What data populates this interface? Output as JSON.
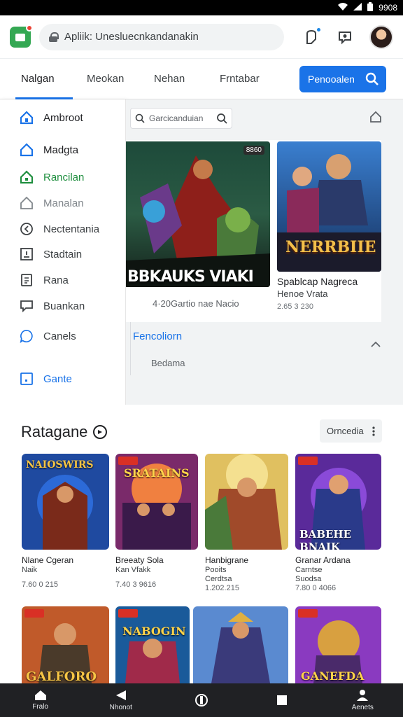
{
  "status_bar": {
    "time": "9908"
  },
  "browser": {
    "url": "Apliik: Unesluecnkandanakin"
  },
  "tabs": [
    {
      "label": "Nalgan"
    },
    {
      "label": "Meokan"
    },
    {
      "label": "Nehan"
    },
    {
      "label": "Frntabar"
    }
  ],
  "cta": {
    "label": "Penooalen"
  },
  "sidebar": {
    "items": [
      {
        "label": "Ambroot",
        "icon": "home-icon"
      },
      {
        "label": "Madgta",
        "icon": "home-icon"
      },
      {
        "label": "Rancilan",
        "icon": "home-icon"
      },
      {
        "label": "Manalan",
        "icon": "home-icon"
      },
      {
        "label": "Nectentania",
        "icon": "compass-icon"
      },
      {
        "label": "Stadtain",
        "icon": "file-icon"
      },
      {
        "label": "Rana",
        "icon": "list-icon"
      },
      {
        "label": "Buankan",
        "icon": "chat-icon"
      },
      {
        "label": "Canels",
        "icon": "bubble-icon"
      },
      {
        "label": "Gante",
        "icon": "square-icon"
      }
    ]
  },
  "main": {
    "search_placeholder": "Garcicanduian",
    "featured": {
      "title": "BBKAUKS VIAKI",
      "badge": "8860",
      "caption": "4·20Gartio nae Nacio"
    },
    "side_featured": {
      "logo": "NERRBIIE",
      "title": "Spablcap Nagreca",
      "sub": "Henoe Vrata",
      "meta": "2.65 3 230"
    },
    "section_link": "Fencoliorn",
    "section_sub": "Bedama"
  },
  "section2": {
    "title": "Ratagane",
    "sort_label": "Orncedia",
    "cards": [
      {
        "title": "Nlane Cgeran",
        "sub": "Naik",
        "meta": "7.60 0 215",
        "logo": "NAIOSWIRS"
      },
      {
        "title": "Breeaty Sola",
        "sub": "Kan Vfakk",
        "meta": "7.40 3 9616",
        "logo": "SRATAINS"
      },
      {
        "title": "Hanbigrane",
        "sub": "Pooits\nCerdtsa",
        "meta": "1.202.215",
        "logo": ""
      },
      {
        "title": "Granar Ardana",
        "sub": "Carntse\nSuodsa",
        "meta": "7.80 0 4066",
        "logo": "BABEHE BNAIK"
      },
      {
        "title": "",
        "sub": "",
        "meta": "",
        "logo": "GALFORO"
      },
      {
        "title": "",
        "sub": "",
        "meta": "",
        "logo": "NABOGIN"
      },
      {
        "title": "",
        "sub": "",
        "meta": "",
        "logo": ""
      },
      {
        "title": "",
        "sub": "",
        "meta": "",
        "logo": "GANEFDA"
      }
    ]
  },
  "bottom_nav": [
    {
      "label": "Fralo",
      "icon": "home-icon"
    },
    {
      "label": "Nhonot",
      "icon": "back-icon"
    },
    {
      "label": "",
      "icon": "circle-icon"
    },
    {
      "label": "",
      "icon": "square-icon"
    },
    {
      "label": "Aenets",
      "icon": "person-icon"
    }
  ]
}
